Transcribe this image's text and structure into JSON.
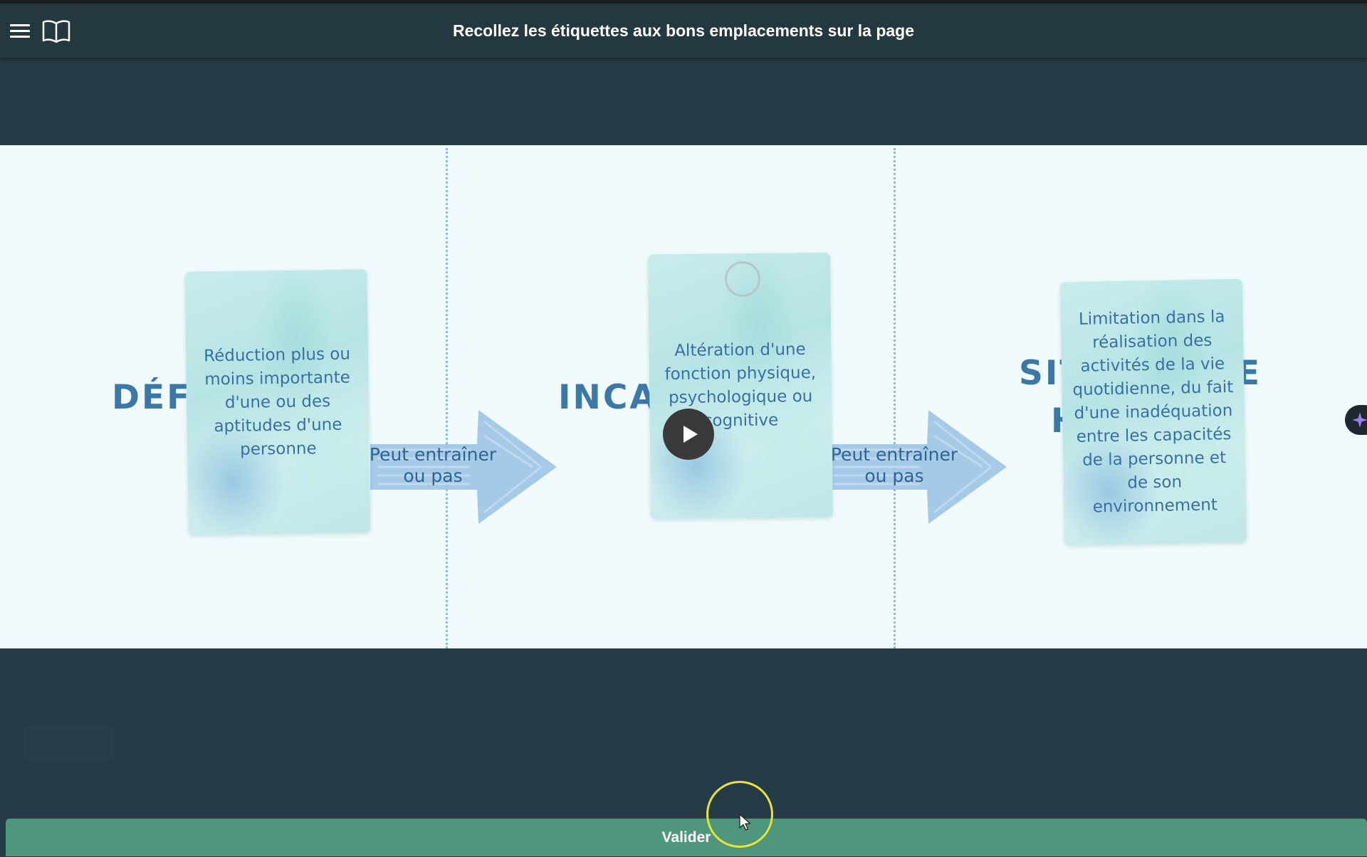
{
  "header": {
    "title": "Recollez les étiquettes aux bons emplacements sur la page",
    "menu_icon": "hamburger-menu-icon",
    "book_icon": "book-icon"
  },
  "stage": {
    "headings": {
      "left": "DÉFI",
      "center": "INCA",
      "right_line1": "SIT",
      "right_line1_tail": "DE",
      "right_line2": "H"
    },
    "cards": [
      {
        "text": "Réduction plus ou moins importante d'une ou des aptitudes d'une personne"
      },
      {
        "text": "Altération d'une fonction physique, psychologique ou cognitive"
      },
      {
        "text": "Limitation dans la réalisation des activités de la vie quotidienne, du fait d'une inadéquation entre les capacités de la personne et de son environnement"
      }
    ],
    "arrows": [
      {
        "line1": "Peut entraîner",
        "line2": "ou pas"
      },
      {
        "line1": "Peut entraîner",
        "line2": "ou pas"
      }
    ],
    "play_icon": "play-icon",
    "ai_icon": "sparkle-icon"
  },
  "footer": {
    "validate_label": "Valider"
  },
  "colors": {
    "background": "#253c47",
    "header": "#24383f",
    "stage": "#f1fafc",
    "heading_text": "#3a78a8",
    "card_text": "#3a6fa2",
    "validate": "#4e977c",
    "cursor_highlight": "#e8e23a"
  }
}
